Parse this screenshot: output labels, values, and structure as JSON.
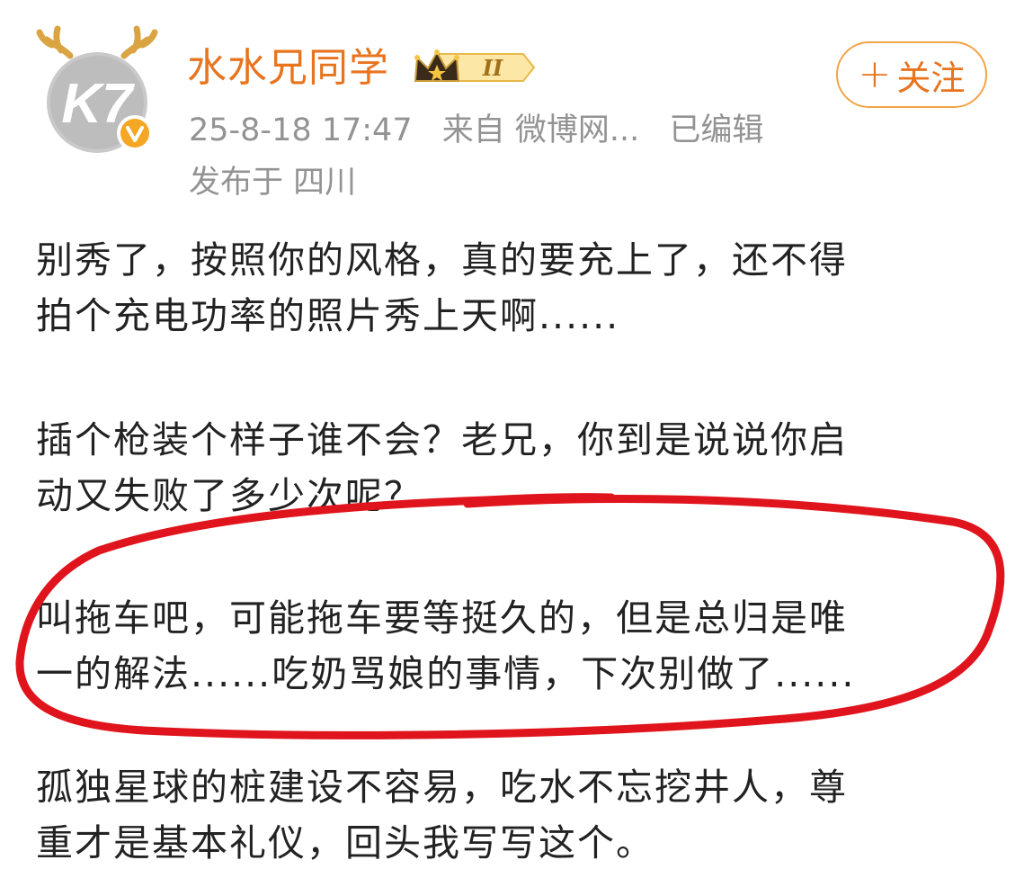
{
  "post_header": {
    "username": "水水兄同学",
    "level_badge": "II",
    "avatar_icon": "k7-avatar-with-antlers",
    "verified_icon": "verified-v-badge",
    "crown_icon": "crown-icon",
    "timestamp": "25-8-18 17:47",
    "source": "来自 微博网...",
    "edited": "已编辑",
    "location": "发布于 四川",
    "follow_label": "关注",
    "follow_plus": "+"
  },
  "post_body": {
    "paragraphs": [
      [
        "别秀了，按照你的风格，真的要充上了，还不得",
        "拍个充电功率的照片秀上天啊......"
      ],
      [
        "插个枪装个样子谁不会？老兄，你到是说说你启",
        "动又失败了多少次呢？"
      ],
      [
        "叫拖车吧，可能拖车要等挺久的，但是总归是唯",
        "一的解法......吃奶骂娘的事情，下次别做了......"
      ],
      [
        "孤独星球的桩建设不容易，吃水不忘挖井人，尊",
        "重才是基本礼仪，回头我写写这个。"
      ]
    ]
  },
  "colors": {
    "username": "#e8741e",
    "meta": "#939393",
    "follow_border": "#f0a548",
    "annotation_circle": "#e0141c",
    "verified_badge": "#f5a623"
  },
  "annotation": {
    "shape": "hand-drawn-red-ellipse",
    "highlights_paragraph_index": 2
  }
}
